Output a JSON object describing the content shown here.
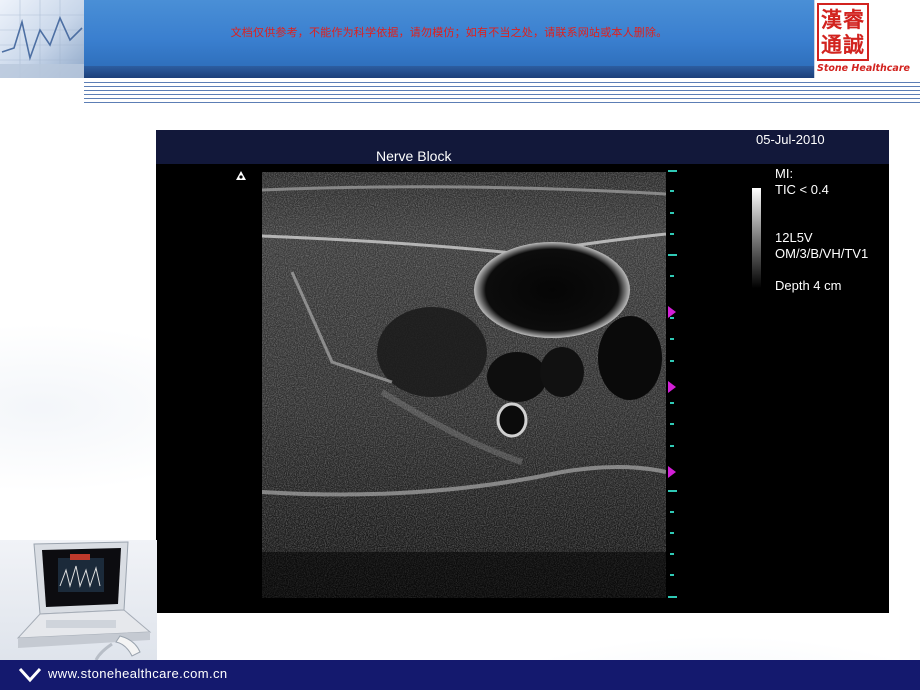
{
  "header": {
    "notice": "文档仅供参考，不能作为科学依据，请勿模仿；如有不当之处，请联系网站或本人删除。",
    "logo_seal_line1": "漢睿",
    "logo_seal_line2": "通誠",
    "logo_text": "Stone Healthcare"
  },
  "ultrasound": {
    "date": "05-Jul-2010",
    "title": "Nerve Block",
    "info": {
      "mi": "MI:",
      "tic": "TIC < 0.4",
      "probe": "12L5V",
      "mode": "OM/3/B/VH/TV1",
      "depth": "Depth 4 cm"
    },
    "colors": {
      "panel_bg": "#000000",
      "topbar_bg": "#12183a",
      "depth_marker": "#2fc9b5",
      "focus_marker": "#d21fd6"
    }
  },
  "footer": {
    "url": "www.stonehealthcare.com.cn"
  },
  "icons": {
    "probe_orientation": "probe-orientation-icon",
    "footer_chevron": "chevron-down-icon"
  },
  "colors": {
    "header_blue": "#3a7fcf",
    "footer_navy": "#14196e",
    "notice_red": "#e0201c"
  }
}
